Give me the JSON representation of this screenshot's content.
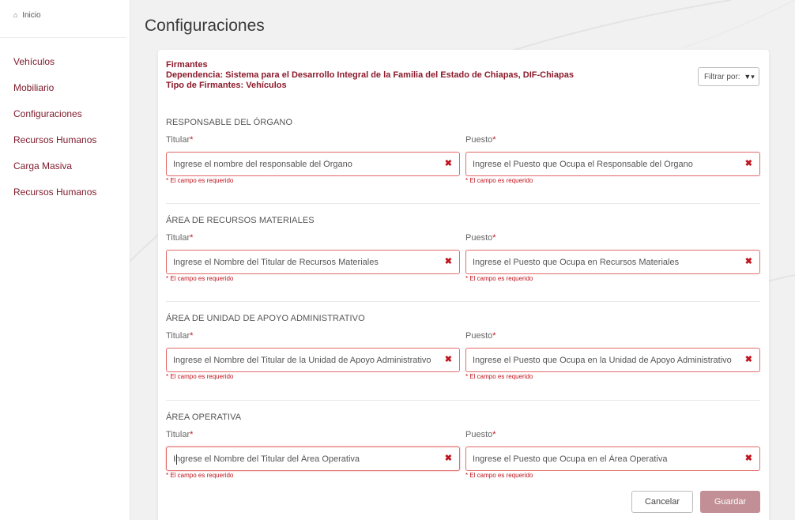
{
  "sidebar": {
    "home": "Inicio",
    "items": [
      {
        "label": "Vehículos"
      },
      {
        "label": "Mobiliario"
      },
      {
        "label": "Configuraciones"
      },
      {
        "label": "Recursos Humanos"
      },
      {
        "label": "Carga Masiva"
      },
      {
        "label": "Recursos Humanos"
      }
    ]
  },
  "page": {
    "title": "Configuraciones"
  },
  "card": {
    "line1": "Firmantes",
    "line2": "Dependencia: Sistema para el Desarrollo Integral de la Familia del Estado de Chiapas, DIF-Chiapas",
    "line3": "Tipo de Firmantes: Vehículos",
    "filter_label": "Filtrar por:"
  },
  "labels": {
    "titular": "Titular",
    "puesto": "Puesto",
    "required_mark": "*",
    "error": "* El campo es requerido"
  },
  "sections": [
    {
      "title": "RESPONSABLE DEL ÓRGANO",
      "titular_placeholder": "Ingrese el nombre del responsable del Órgano",
      "puesto_placeholder": "Ingrese el Puesto que Ocupa el Responsable del Órgano"
    },
    {
      "title": "ÁREA DE RECURSOS MATERIALES",
      "titular_placeholder": "Ingrese el Nombre del Titular de Recursos Materiales",
      "puesto_placeholder": "Ingrese el Puesto que Ocupa en Recursos Materiales"
    },
    {
      "title": "ÁREA DE UNIDAD DE APOYO ADMINISTRATIVO",
      "titular_placeholder": "Ingrese el Nombre del Titular de la Unidad de Apoyo Administrativo",
      "puesto_placeholder": "Ingrese el Puesto que Ocupa en la Unidad de Apoyo Administrativo"
    },
    {
      "title": "ÁREA OPERATIVA",
      "titular_placeholder": "Ingrese el Nombre del Titular del Área Operativa",
      "puesto_placeholder": "Ingrese el Puesto que Ocupa en el Área Operativa"
    }
  ],
  "buttons": {
    "cancel": "Cancelar",
    "save": "Guardar"
  },
  "colors": {
    "accent": "#8b1a2b",
    "error": "#c0141e",
    "save_bg": "#c18f95"
  }
}
